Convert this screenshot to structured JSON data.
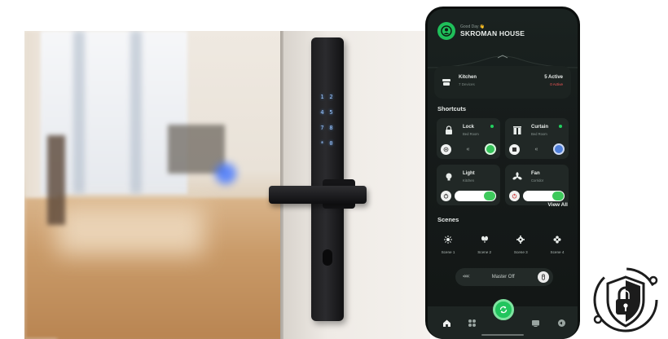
{
  "header": {
    "greeting": "Good Day 👋",
    "home_name": "SKROMAN HOUSE"
  },
  "room": {
    "name": "Kitchen",
    "devices": "7 Devices",
    "active": "5 Active",
    "on": "0 Active"
  },
  "shortcuts": {
    "title": "Shortcuts",
    "items": [
      {
        "name": "Lock",
        "room": "Bed Room",
        "icon": "padlock-icon",
        "control": "buttons",
        "status": "on"
      },
      {
        "name": "Curtain",
        "room": "Bed Room",
        "icon": "curtain-icon",
        "control": "buttons",
        "status": "on"
      },
      {
        "name": "Light",
        "room": "Kitchen",
        "icon": "bulb-icon",
        "control": "toggle",
        "status": "on"
      },
      {
        "name": "Fan",
        "room": "Corridor",
        "icon": "fan-icon",
        "control": "toggle",
        "status": "on"
      }
    ],
    "view_all": "View All"
  },
  "scenes": {
    "title": "Scenes",
    "items": [
      {
        "label": "Scene 1",
        "icon": "sun-icon"
      },
      {
        "label": "Scene 2",
        "icon": "plant-icon"
      },
      {
        "label": "Scene 3",
        "icon": "gear-icon"
      },
      {
        "label": "Scene 4",
        "icon": "flower-icon"
      }
    ]
  },
  "master": {
    "chevrons": "<<<",
    "label": "Master Off"
  },
  "keypad": [
    "1",
    "2",
    "4",
    "5",
    "7",
    "8",
    "*",
    "0"
  ],
  "colors": {
    "accent": "#22c55e",
    "screen": "#161b1a",
    "alert": "#ff5a5a"
  }
}
